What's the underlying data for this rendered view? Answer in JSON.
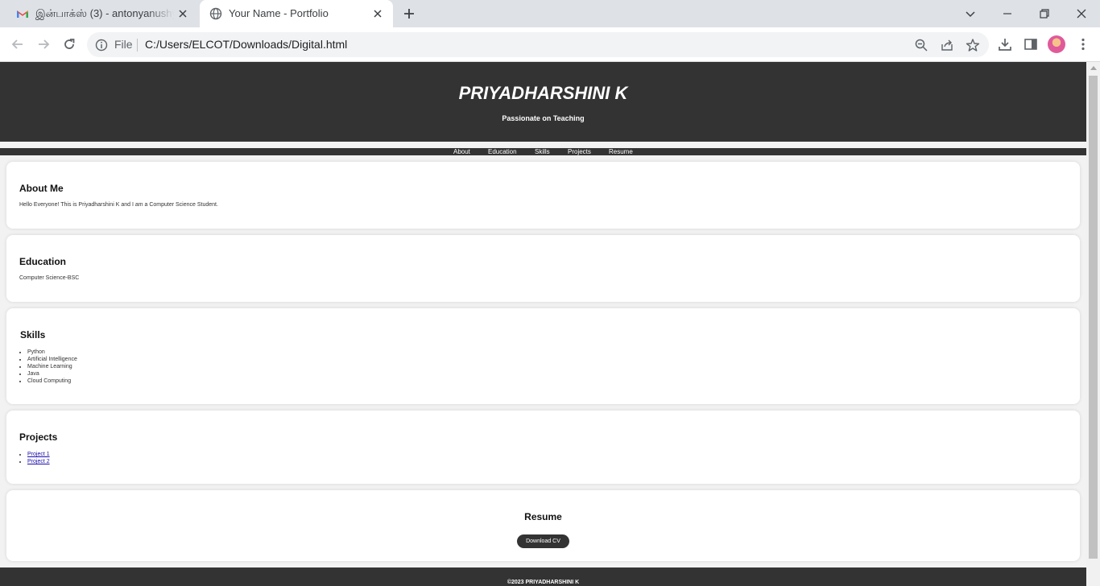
{
  "browser": {
    "tabs": [
      {
        "title": "இன்பாக்ஸ் (3) - antonyanushya",
        "favicon": "gmail-icon",
        "active": false
      },
      {
        "title": "Your Name - Portfolio",
        "favicon": "globe-icon",
        "active": true
      }
    ],
    "omnibox": {
      "scheme_label": "File",
      "url": "C:/Users/ELCOT/Downloads/Digital.html"
    }
  },
  "site": {
    "title": "PRIYADHARSHINI K",
    "tagline": "Passionate on Teaching",
    "nav": [
      "About",
      "Education",
      "Skills",
      "Projects",
      "Resume"
    ],
    "about": {
      "heading": "About Me",
      "text": "Hello Everyone! This is Priyadharshini K and I am a Computer Science Student."
    },
    "education": {
      "heading": "Education",
      "text": "Computer Science-BSC"
    },
    "skills": {
      "heading": "Skills",
      "items": [
        "Python",
        "Artificial Intelligence",
        "Machine Learning",
        "Java",
        "Cloud Computing"
      ]
    },
    "projects": {
      "heading": "Projects",
      "items": [
        "Project 1",
        "Project 2"
      ]
    },
    "resume": {
      "heading": "Resume",
      "button": "Download CV"
    },
    "footer": "©2023 PRIYADHARSHINI K"
  },
  "colors": {
    "header_bg": "#333333",
    "page_bg": "#f2f2f2",
    "card_bg": "#ffffff",
    "link": "#1a0dab"
  }
}
